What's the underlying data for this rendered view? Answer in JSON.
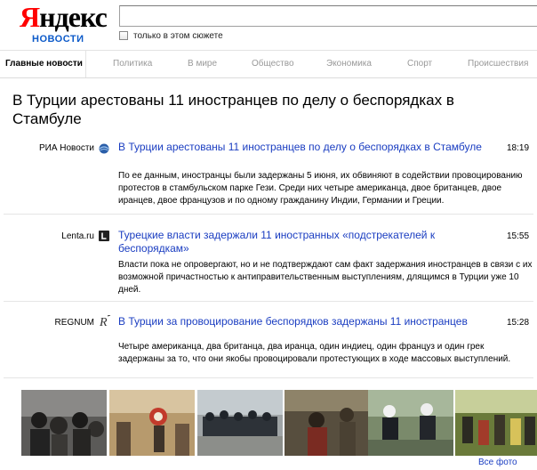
{
  "header": {
    "logo_red": "Я",
    "logo_black": "ндекс",
    "sub_logo": "НОВОСТИ",
    "search_value": "",
    "filter_label": "только в этом сюжете"
  },
  "nav": {
    "items": [
      {
        "label": "Главные новости",
        "active": true
      },
      {
        "label": "Политика"
      },
      {
        "label": "В мире"
      },
      {
        "label": "Общество"
      },
      {
        "label": "Экономика"
      },
      {
        "label": "Спорт"
      },
      {
        "label": "Происшествия"
      }
    ]
  },
  "story": {
    "title": "В Турции арестованы 11 иностранцев по делу о беспорядках в Стамбуле"
  },
  "items": [
    {
      "source": "РИА Новости",
      "icon": "ria-globe-icon",
      "title": "В Турции арестованы 11 иностранцев по делу о беспорядках в Стамбуле",
      "time": "18:19",
      "text": "По ее данным, иностранцы были задержаны 5 июня, их обвиняют в содействии провоцированию протестов в стамбульском парке Гези. Среди них четыре американца, двое британцев, двое иранцев, двое французов и по одному гражданину Индии, Германии и Греции."
    },
    {
      "source": "Lenta.ru",
      "icon": "lenta-l-icon",
      "title": "Турецкие власти задержали 11 иностранных «подстрекателей к беспорядкам»",
      "time": "15:55",
      "text": "Власти пока не опровергают, но и не подтверждают сам факт задержания иностранцев в связи с их возможной причастностью к антиправительственным выступлениям, длящимся в Турции уже 10 дней."
    },
    {
      "source": "REGNUM",
      "icon": "regnum-r-icon",
      "title": "В Турции за провоцирование беспорядков задержаны 11 иностранцев",
      "time": "15:28",
      "text": "Четыре американца, два британца, два иранца, один индиец, один француз и один грек задержаны за то, что они якобы провоцировали протестующих в ходе массовых выступлений."
    }
  ],
  "photos": {
    "all_photos_label": "Все фото"
  }
}
